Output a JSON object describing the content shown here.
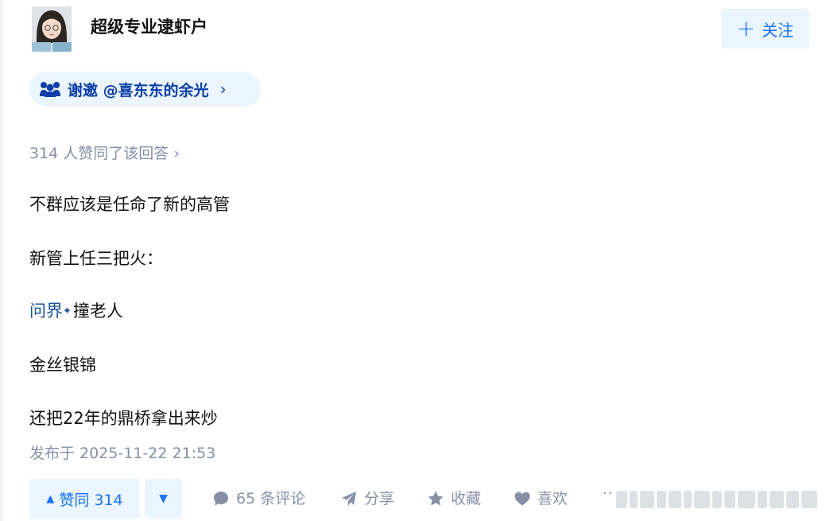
{
  "author": {
    "name": "超级专业逮虾户",
    "follow_label": "关注"
  },
  "invite": {
    "label": "谢邀 @喜东东的余光",
    "chevron": "›"
  },
  "answer": {
    "upvote_summary": "314 人赞同了该回答 ›",
    "paragraphs": [
      "不群应该是任命了新的高管",
      "新管上任三把火：",
      "撞老人",
      "金丝银锦",
      "还把22年的鼎桥拿出来炒"
    ],
    "keyword_link": "问界",
    "publish_time": "发布于 2025-11-22 21:53"
  },
  "actions": {
    "vote_up_label": "赞同 314",
    "comment_label": "65 条评论",
    "share_label": "分享",
    "collect_label": "收藏",
    "like_label": "喜欢",
    "more_label": "··"
  },
  "colors": {
    "accent": "#1772f6",
    "accent_bg": "#ebf5ff",
    "muted": "#8590a6",
    "link": "#175199"
  },
  "icons": [
    "plus-icon",
    "group-icon",
    "chevron-right-icon",
    "sparkle-icon",
    "triangle-up-icon",
    "triangle-down-icon",
    "comment-icon",
    "share-icon",
    "star-icon",
    "heart-icon",
    "more-icon"
  ]
}
